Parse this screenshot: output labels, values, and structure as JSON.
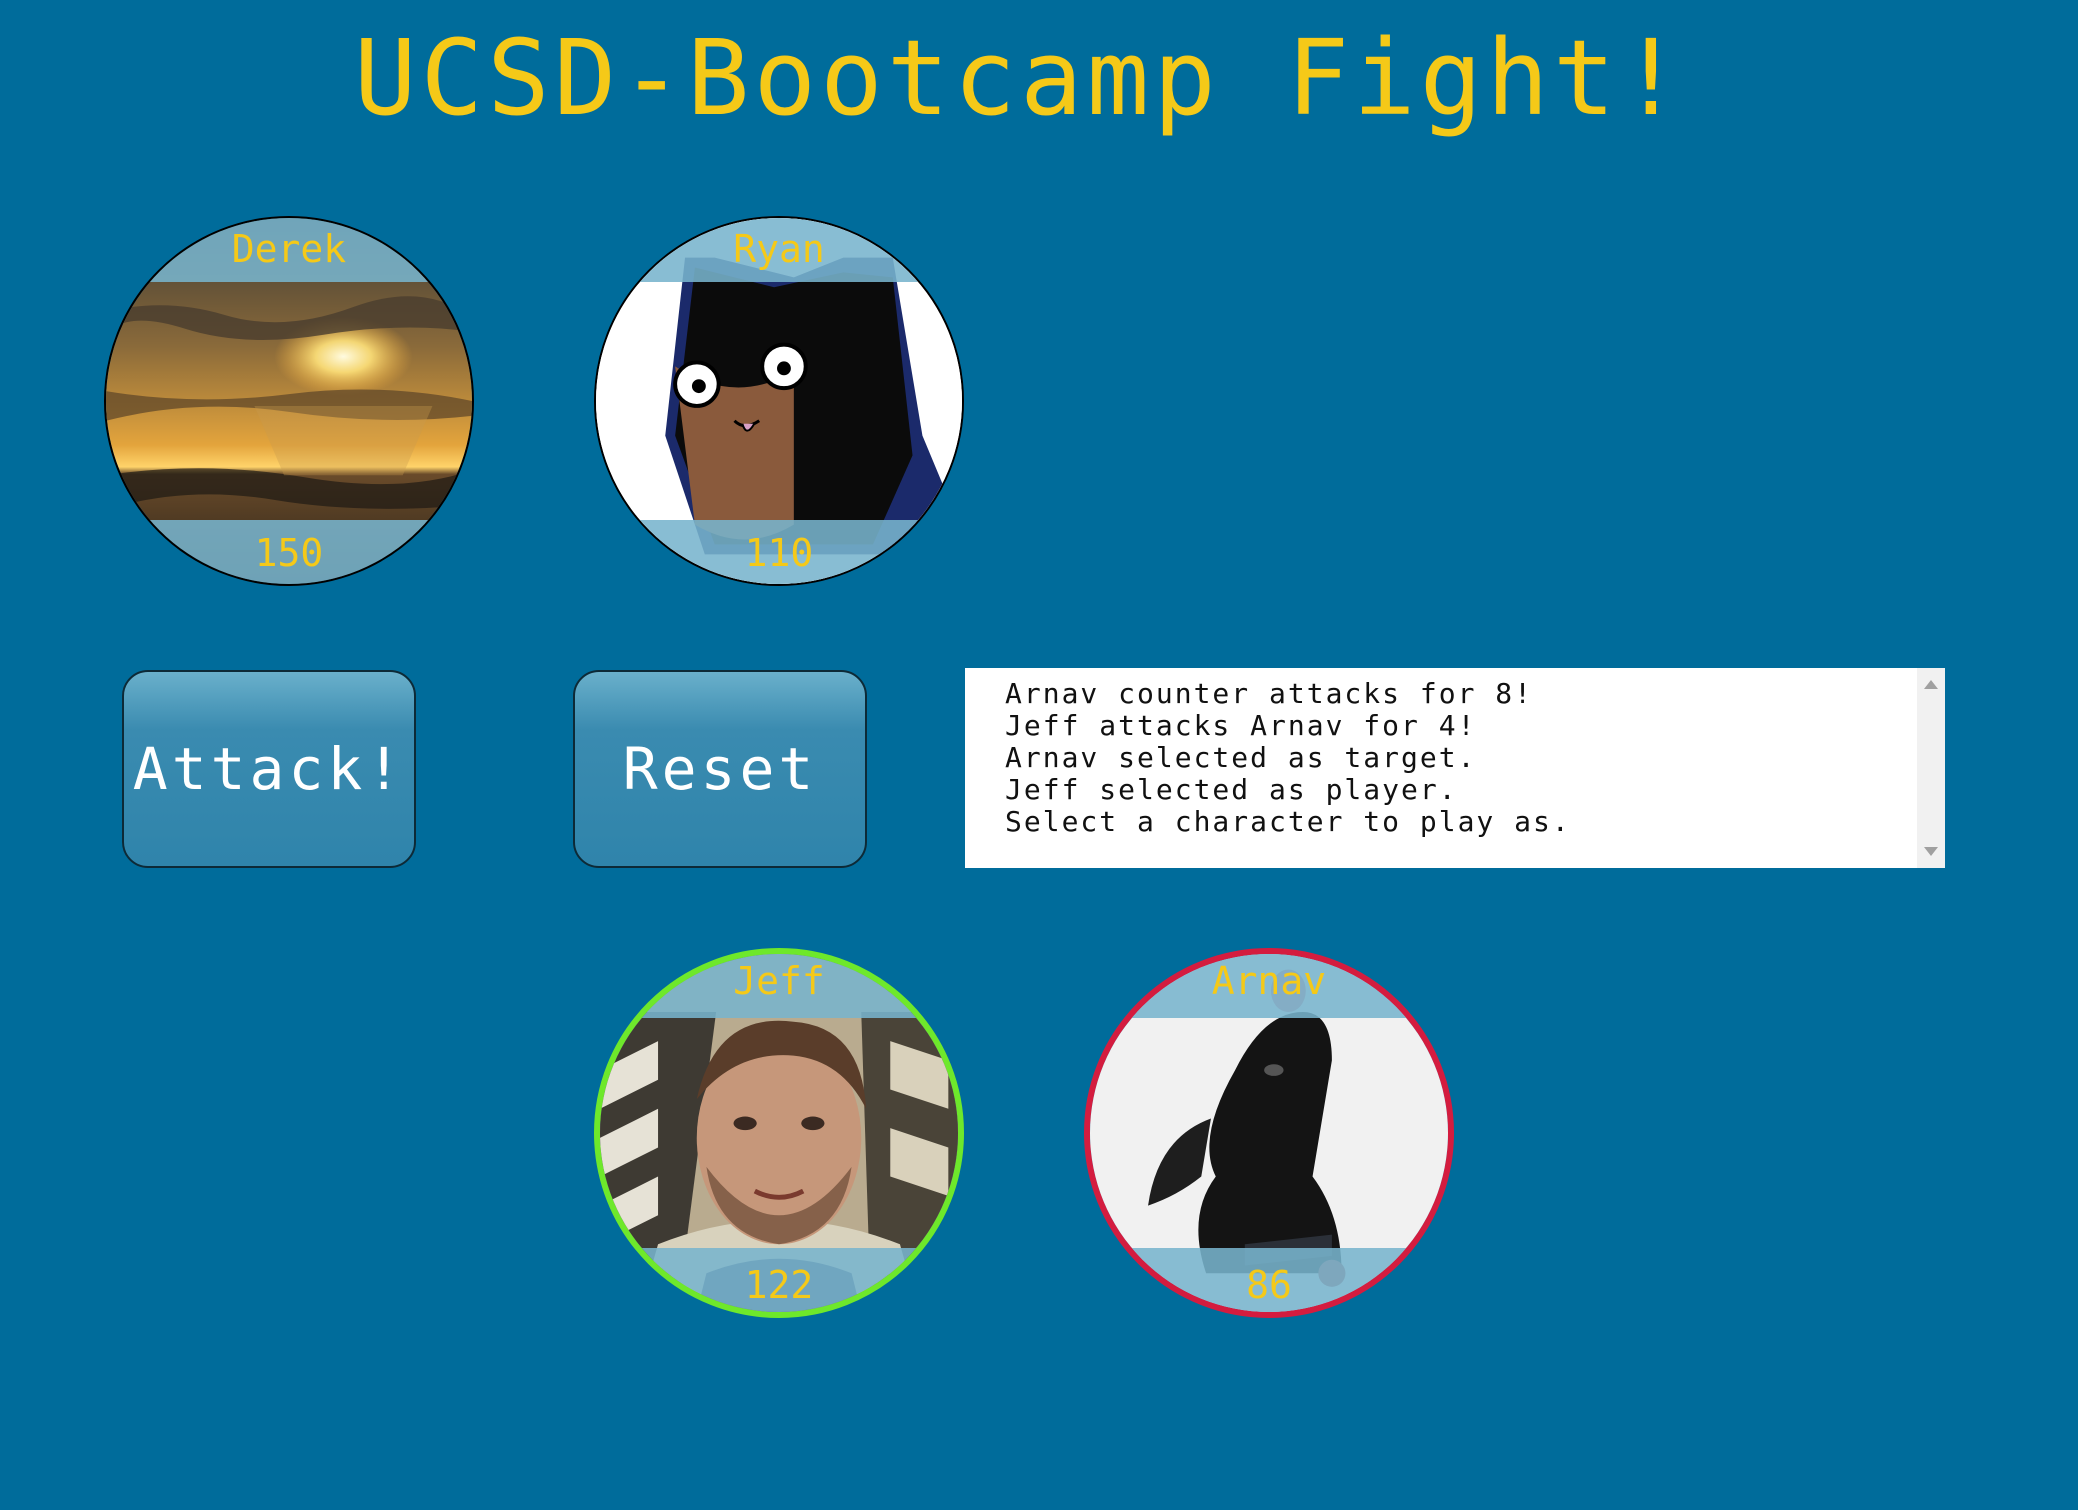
{
  "title": "UCSD-Bootcamp Fight!",
  "characters": {
    "derek": {
      "name": "Derek",
      "hp": "150",
      "picture": "sunset-over-ocean"
    },
    "ryan": {
      "name": "Ryan",
      "hp": "110",
      "picture": "cartoon-batman-face"
    },
    "jeff": {
      "name": "Jeff",
      "hp": "122",
      "picture": "man-selfie",
      "role": "player"
    },
    "arnav": {
      "name": "Arnav",
      "hp": "86",
      "picture": "black-puppy",
      "role": "target"
    }
  },
  "buttons": {
    "attack_label": "Attack!",
    "reset_label": "Reset"
  },
  "log": {
    "lines": [
      "Arnav counter attacks for 8!",
      "Jeff attacks Arnav for 4!",
      "Arnav selected as target.",
      "Jeff selected as player.",
      "Select a character to play as."
    ]
  },
  "colors": {
    "background": "#006c9b",
    "accent_text": "#f5c918",
    "player_ring": "#6ee82b",
    "target_ring": "#d41c3f"
  }
}
